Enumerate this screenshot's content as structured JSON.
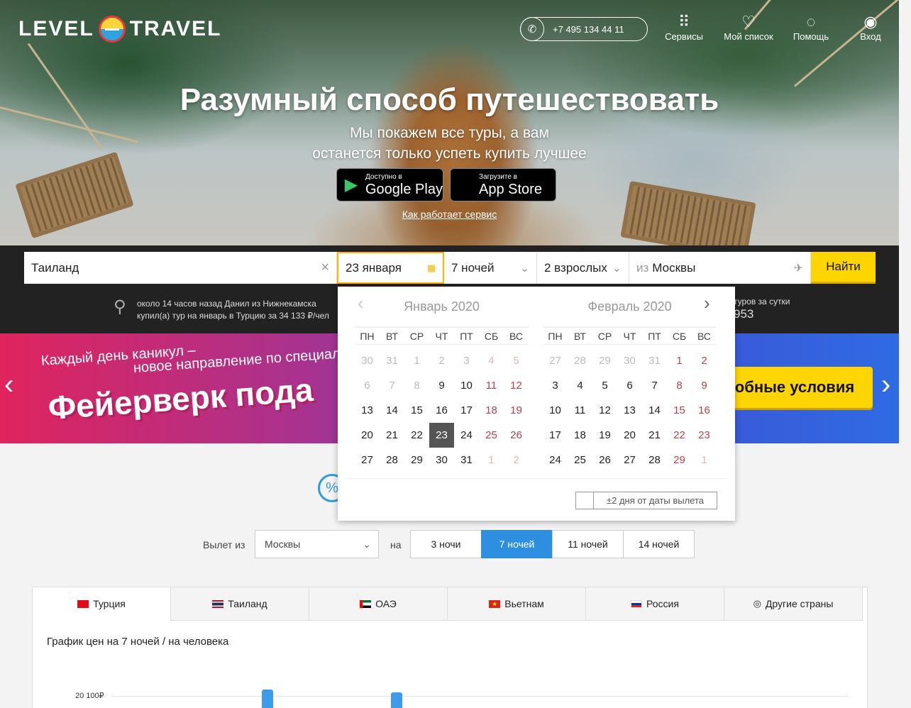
{
  "header": {
    "logo_left": "LEVEL",
    "logo_right": "TRAVEL",
    "phone": "+7 495 134 44 11",
    "nav": [
      {
        "label": "Сервисы",
        "icon": "grid-icon"
      },
      {
        "label": "Мой список",
        "icon": "heart-icon"
      },
      {
        "label": "Помощь",
        "icon": "bulb-icon"
      },
      {
        "label": "Вход",
        "icon": "user-icon"
      }
    ]
  },
  "hero": {
    "title": "Разумный способ путешествовать",
    "subtitle_line1": "Мы покажем все туры, а вам",
    "subtitle_line2": "останется только успеть купить лучшее",
    "google_small": "Доступно в",
    "google_big": "Google Play",
    "apple_small": "Загрузите в",
    "apple_big": "App Store",
    "how_link": "Как работает сервис"
  },
  "search": {
    "destination": "Таиланд",
    "date": "23 января",
    "nights": "7 ночей",
    "travelers": "2 взрослых",
    "from_prefix": "из",
    "from_city": "Москвы",
    "submit": "Найти"
  },
  "ticker": {
    "line1": "около 14 часов назад Данил из Нижнекамска",
    "line2": "купил(а) тур на январь в Турцию за 34 133 ₽/чел",
    "right_line1": "туров за сутки",
    "right_line2": "953"
  },
  "banner": {
    "line1": "Каждый день каникул –",
    "line2": "новое направление по специал",
    "headline": "Фейерверк пода",
    "button": "обные условия"
  },
  "calendar": {
    "months": [
      {
        "title": "Январь 2020",
        "weeks": [
          [
            [
              "30",
              1
            ],
            [
              "31",
              1
            ],
            [
              "1",
              1
            ],
            [
              "2",
              1
            ],
            [
              "3",
              1
            ],
            [
              "4",
              1
            ],
            [
              "5",
              1
            ]
          ],
          [
            [
              "6",
              1
            ],
            [
              "7",
              1
            ],
            [
              "8",
              1
            ],
            [
              "9",
              0
            ],
            [
              "10",
              0
            ],
            [
              "11",
              0
            ],
            [
              "12",
              0
            ]
          ],
          [
            [
              "13",
              0
            ],
            [
              "14",
              0
            ],
            [
              "15",
              0
            ],
            [
              "16",
              0
            ],
            [
              "17",
              0
            ],
            [
              "18",
              0
            ],
            [
              "19",
              0
            ]
          ],
          [
            [
              "20",
              0
            ],
            [
              "21",
              0
            ],
            [
              "22",
              0
            ],
            [
              "23",
              2
            ],
            [
              "24",
              0
            ],
            [
              "25",
              0
            ],
            [
              "26",
              0
            ]
          ],
          [
            [
              "27",
              0
            ],
            [
              "28",
              0
            ],
            [
              "29",
              0
            ],
            [
              "30",
              0
            ],
            [
              "31",
              0
            ],
            [
              "1",
              1
            ],
            [
              "2",
              1
            ]
          ]
        ]
      },
      {
        "title": "Февраль 2020",
        "weeks": [
          [
            [
              "27",
              1
            ],
            [
              "28",
              1
            ],
            [
              "29",
              1
            ],
            [
              "30",
              1
            ],
            [
              "31",
              1
            ],
            [
              "1",
              0
            ],
            [
              "2",
              0
            ]
          ],
          [
            [
              "3",
              0
            ],
            [
              "4",
              0
            ],
            [
              "5",
              0
            ],
            [
              "6",
              0
            ],
            [
              "7",
              0
            ],
            [
              "8",
              0
            ],
            [
              "9",
              0
            ]
          ],
          [
            [
              "10",
              0
            ],
            [
              "11",
              0
            ],
            [
              "12",
              0
            ],
            [
              "13",
              0
            ],
            [
              "14",
              0
            ],
            [
              "15",
              0
            ],
            [
              "16",
              0
            ]
          ],
          [
            [
              "17",
              0
            ],
            [
              "18",
              0
            ],
            [
              "19",
              0
            ],
            [
              "20",
              0
            ],
            [
              "21",
              0
            ],
            [
              "22",
              0
            ],
            [
              "23",
              0
            ]
          ],
          [
            [
              "24",
              0
            ],
            [
              "25",
              0
            ],
            [
              "26",
              0
            ],
            [
              "27",
              0
            ],
            [
              "28",
              0
            ],
            [
              "29",
              0
            ],
            [
              "1",
              1
            ]
          ]
        ]
      }
    ],
    "weekdays": [
      "ПН",
      "ВТ",
      "СР",
      "ЧТ",
      "ПТ",
      "СБ",
      "ВС"
    ],
    "flex_label": "±2 дня от даты вылета"
  },
  "filters": {
    "from_label": "Вылет из",
    "from_value": "Москвы",
    "on_label": "на",
    "nights": [
      "3 ночи",
      "7 ночей",
      "11 ночей",
      "14 ночей"
    ],
    "active_night": 1
  },
  "countries": [
    {
      "label": "Турция",
      "flag": "flag-tr",
      "active": true
    },
    {
      "label": "Таиланд",
      "flag": "flag-th"
    },
    {
      "label": "ОАЭ",
      "flag": "flag-ae"
    },
    {
      "label": "Вьетнам",
      "flag": "flag-vn"
    },
    {
      "label": "Россия",
      "flag": "flag-ru"
    },
    {
      "label": "Другие страны",
      "flag": "globe-icon"
    }
  ],
  "chart": {
    "title": "График цен на 7 ночей / на человека",
    "ytick": "20 100₽"
  },
  "colors": {
    "accent_yellow": "#ffd500",
    "accent_blue": "#2e8fe0",
    "weekend_red": "#b8404a"
  }
}
